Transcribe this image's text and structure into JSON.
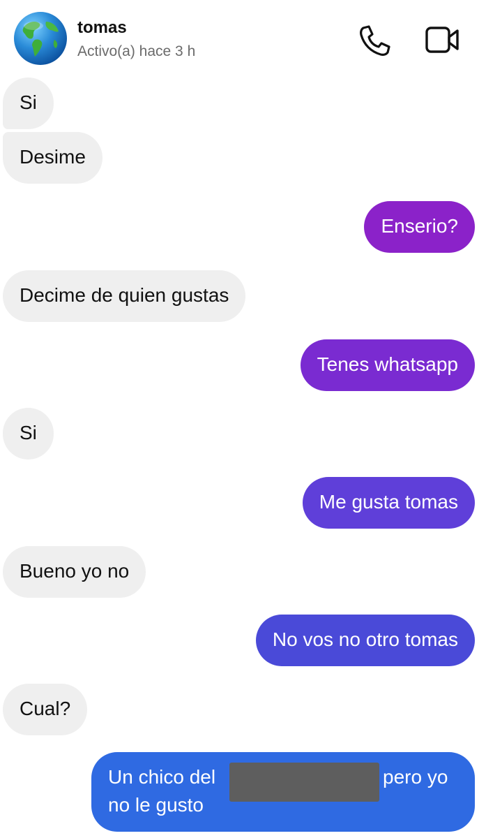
{
  "header": {
    "name": "tomas",
    "status": "Activo(a) hace 3 h",
    "call_icon": "phone-icon",
    "video_icon": "video-camera-icon",
    "avatar_icon": "globe-icon"
  },
  "colors": {
    "incoming_bg": "#efefef",
    "outgoing_gradient": [
      "#8b22c9",
      "#7a2bd1",
      "#5f3fd9",
      "#4a4ad8",
      "#2f6ae2"
    ]
  },
  "messages": [
    {
      "from": "them",
      "text": "Si"
    },
    {
      "from": "them",
      "text": "Desime"
    },
    {
      "from": "me",
      "text": "Enserio?"
    },
    {
      "from": "them",
      "text": "Decime de quien gustas"
    },
    {
      "from": "me",
      "text": "Tenes whatsapp"
    },
    {
      "from": "them",
      "text": "Si"
    },
    {
      "from": "me",
      "text": "Me gusta tomas"
    },
    {
      "from": "them",
      "text": "Bueno yo no"
    },
    {
      "from": "me",
      "text": "No vos no otro tomas"
    },
    {
      "from": "them",
      "text": "Cual?"
    },
    {
      "from": "me",
      "text_part1": "Un chico del",
      "text_part2": "pero yo",
      "text_line2": "no le gusto"
    }
  ]
}
